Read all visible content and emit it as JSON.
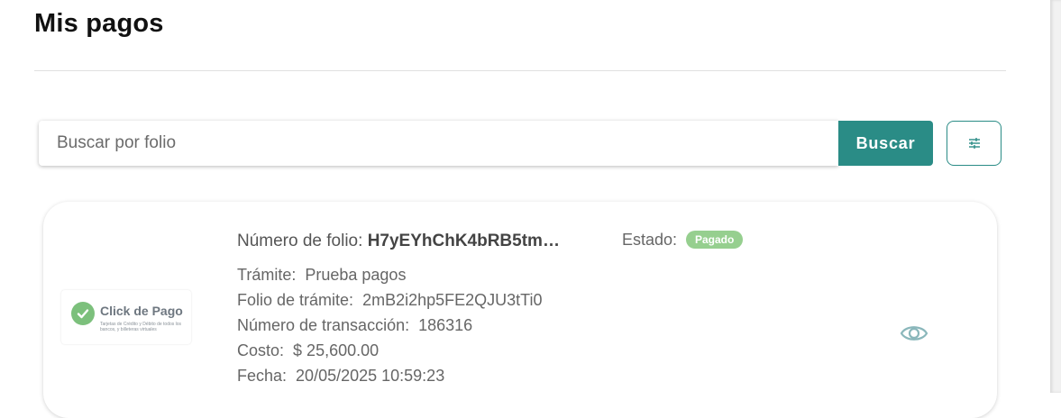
{
  "page": {
    "title": "Mis pagos"
  },
  "search": {
    "placeholder": "Buscar por folio",
    "value": "",
    "button_label": "Buscar"
  },
  "filter": {
    "icon": "sliders-icon"
  },
  "colors": {
    "accent": "#2a8c86",
    "badge_paid": "#96cf8f",
    "logo_check": "#7cc07c"
  },
  "payment": {
    "logo": {
      "name": "Click de Pago",
      "tagline": "Tarjetas de Crédito y Débito de todos los bancos, y billeteras virtuales"
    },
    "folio_label": "Número de folio:",
    "folio_value": "H7yEYhChK4bRB5tm…",
    "estado_label": "Estado:",
    "estado_value": "Pagado",
    "details": [
      {
        "label": "Trámite:",
        "value": "Prueba pagos"
      },
      {
        "label": "Folio de trámite:",
        "value": "2mB2i2hp5FE2QJU3tTi0"
      },
      {
        "label": "Número de transacción:",
        "value": "186316"
      },
      {
        "label": "Costo:",
        "value": "$ 25,600.00"
      },
      {
        "label": "Fecha:",
        "value": "20/05/2025 10:59:23"
      }
    ],
    "view_icon": "eye-icon"
  }
}
